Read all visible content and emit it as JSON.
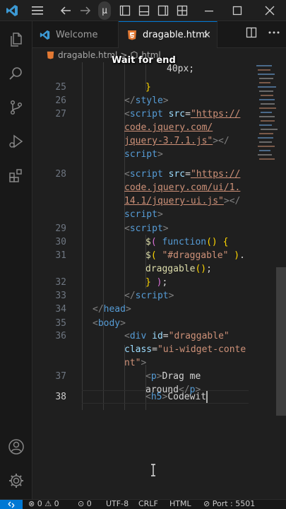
{
  "window": {
    "pill_text": "μ"
  },
  "tabs": [
    {
      "label": "Welcome",
      "icon": "vscode-icon"
    },
    {
      "label": "dragable.html",
      "icon": "html5-icon",
      "close": "✕"
    }
  ],
  "breadcrumb": {
    "file": "dragable.html",
    "separator": ">",
    "node": "html"
  },
  "overlay": {
    "text": "Wait for end"
  },
  "editor": {
    "current_line": 38,
    "lines": [
      {
        "n": "",
        "parts": [
          {
            "c": "t-plain",
            "t": "40px;"
          }
        ]
      },
      {
        "n": "25",
        "parts": [
          {
            "c": "t-paren",
            "t": "}"
          }
        ]
      },
      {
        "n": "26",
        "parts": [
          {
            "c": "t-br",
            "t": "</"
          },
          {
            "c": "t-tag",
            "t": "style"
          },
          {
            "c": "t-br",
            "t": ">"
          }
        ]
      },
      {
        "n": "27",
        "parts": [
          {
            "c": "t-br",
            "t": "<"
          },
          {
            "c": "t-tag",
            "t": "script"
          },
          {
            "c": "t-attr",
            "t": " src"
          },
          {
            "c": "t-plain",
            "t": "="
          },
          {
            "c": "t-str",
            "t": "\"https://"
          }
        ]
      },
      {
        "n": "",
        "parts": [
          {
            "c": "t-str",
            "t": "code.jquery.com/"
          }
        ]
      },
      {
        "n": "",
        "parts": [
          {
            "c": "t-str",
            "t": "jquery-3.7.1.js\""
          },
          {
            "c": "t-br",
            "t": "></"
          }
        ]
      },
      {
        "n": "",
        "parts": [
          {
            "c": "t-tag",
            "t": "script"
          },
          {
            "c": "t-br",
            "t": ">"
          }
        ]
      },
      {
        "n": "28",
        "parts": [
          {
            "c": "t-br",
            "t": "<"
          },
          {
            "c": "t-tag",
            "t": "script"
          },
          {
            "c": "t-attr",
            "t": " src"
          },
          {
            "c": "t-plain",
            "t": "="
          },
          {
            "c": "t-str",
            "t": "\"https://"
          }
        ]
      },
      {
        "n": "",
        "parts": [
          {
            "c": "t-str",
            "t": "code.jquery.com/ui/1."
          }
        ]
      },
      {
        "n": "",
        "parts": [
          {
            "c": "t-str",
            "t": "14.1/jquery-ui.js\""
          },
          {
            "c": "t-br",
            "t": "></"
          }
        ]
      },
      {
        "n": "",
        "parts": [
          {
            "c": "t-tag",
            "t": "script"
          },
          {
            "c": "t-br",
            "t": ">"
          }
        ]
      },
      {
        "n": "29",
        "parts": [
          {
            "c": "t-br",
            "t": "<"
          },
          {
            "c": "t-tag",
            "t": "script"
          },
          {
            "c": "t-br",
            "t": ">"
          }
        ]
      },
      {
        "n": "30",
        "parts": [
          {
            "c": "t-dollar",
            "t": "$"
          },
          {
            "c": "t-paren2",
            "t": "( "
          },
          {
            "c": "t-kw",
            "t": "function"
          },
          {
            "c": "t-paren",
            "t": "() {"
          }
        ]
      },
      {
        "n": "31",
        "parts": [
          {
            "c": "t-dollar",
            "t": "$"
          },
          {
            "c": "t-paren",
            "t": "( "
          },
          {
            "c": "t-strp",
            "t": "\"#draggable\""
          },
          {
            "c": "t-paren",
            "t": " )"
          },
          {
            "c": "t-plain",
            "t": "."
          }
        ]
      },
      {
        "n": "",
        "parts": [
          {
            "c": "t-fn",
            "t": "draggable"
          },
          {
            "c": "t-paren",
            "t": "()"
          },
          {
            "c": "t-plain",
            "t": ";"
          }
        ]
      },
      {
        "n": "32",
        "parts": [
          {
            "c": "t-paren",
            "t": "} "
          },
          {
            "c": "t-paren2",
            "t": ")"
          },
          {
            "c": "t-plain",
            "t": ";"
          }
        ]
      },
      {
        "n": "33",
        "parts": [
          {
            "c": "t-br",
            "t": "</"
          },
          {
            "c": "t-tag",
            "t": "script"
          },
          {
            "c": "t-br",
            "t": ">"
          }
        ]
      },
      {
        "n": "34",
        "parts": [
          {
            "c": "t-br",
            "t": "</"
          },
          {
            "c": "t-tag",
            "t": "head"
          },
          {
            "c": "t-br",
            "t": ">"
          }
        ]
      },
      {
        "n": "35",
        "parts": [
          {
            "c": "t-br",
            "t": "<"
          },
          {
            "c": "t-tag",
            "t": "body"
          },
          {
            "c": "t-br",
            "t": ">"
          }
        ]
      },
      {
        "n": "36",
        "parts": [
          {
            "c": "t-br",
            "t": "<"
          },
          {
            "c": "t-tag",
            "t": "div"
          },
          {
            "c": "t-attr",
            "t": " id"
          },
          {
            "c": "t-plain",
            "t": "="
          },
          {
            "c": "t-strp",
            "t": "\"draggable\""
          }
        ]
      },
      {
        "n": "",
        "parts": [
          {
            "c": "t-attr",
            "t": "class"
          },
          {
            "c": "t-plain",
            "t": "="
          },
          {
            "c": "t-strp",
            "t": "\"ui-widget-conte"
          }
        ]
      },
      {
        "n": "",
        "parts": [
          {
            "c": "t-strp",
            "t": "nt\""
          },
          {
            "c": "t-br",
            "t": ">"
          }
        ]
      },
      {
        "n": "37",
        "parts": [
          {
            "c": "t-br",
            "t": "<"
          },
          {
            "c": "t-tag",
            "t": "p"
          },
          {
            "c": "t-br",
            "t": ">"
          },
          {
            "c": "t-plain",
            "t": "Drag me"
          }
        ]
      },
      {
        "n": "",
        "parts": [
          {
            "c": "t-plain",
            "t": "around"
          },
          {
            "c": "t-br",
            "t": "</"
          },
          {
            "c": "t-tag",
            "t": "p"
          },
          {
            "c": "t-br",
            "t": ">"
          }
        ]
      },
      {
        "n": "38",
        "parts": [
          {
            "c": "t-br",
            "t": "<"
          },
          {
            "c": "t-tag",
            "t": "h5"
          },
          {
            "c": "t-br",
            "t": ">"
          },
          {
            "c": "t-plain",
            "t": "Codewit"
          }
        ]
      }
    ]
  },
  "statusbar": {
    "errors": "0",
    "warnings": "0",
    "ports": "0",
    "encoding": "UTF-8",
    "eol": "CRLF",
    "language": "HTML",
    "port": "Port : 5501"
  },
  "colors": {
    "accent": "#0078d4",
    "html_icon": "#e37933",
    "vscode_icon": "#3c99d4"
  }
}
